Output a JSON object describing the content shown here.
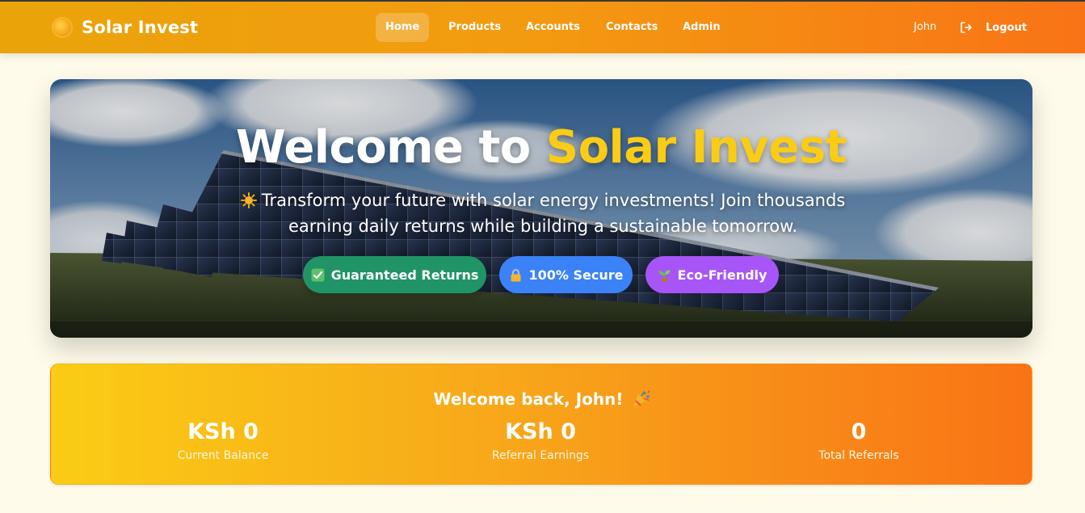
{
  "navbar": {
    "brand_icon": "sun-icon",
    "brand_name": "Solar Invest",
    "items": [
      {
        "label": "Home",
        "active": true
      },
      {
        "label": "Products",
        "active": false
      },
      {
        "label": "Accounts",
        "active": false
      },
      {
        "label": "Contacts",
        "active": false
      },
      {
        "label": "Admin",
        "active": false
      }
    ],
    "user_name": "John",
    "logout_icon": "logout-icon",
    "logout_label": "Logout"
  },
  "hero": {
    "title_prefix": "Welcome to ",
    "title_accent": "Solar Invest",
    "subtitle_icon": "sparkle-sun-icon",
    "subtitle": "Transform your future with solar energy investments! Join thousands earning daily returns while building a sustainable tomorrow.",
    "badges": [
      {
        "icon": "check-box-icon",
        "label": "Guaranteed Returns",
        "color": "#209466"
      },
      {
        "icon": "lock-icon",
        "label": "100% Secure",
        "color": "#3b82f6"
      },
      {
        "icon": "seedling-icon",
        "label": "Eco-Friendly",
        "color": "#a855f7"
      }
    ]
  },
  "summary": {
    "greeting": "Welcome back, John!",
    "greeting_icon": "party-popper-icon",
    "stats": [
      {
        "value": "KSh 0",
        "label": "Current Balance"
      },
      {
        "value": "KSh 0",
        "label": "Referral Earnings"
      },
      {
        "value": "0",
        "label": "Total Referrals"
      }
    ]
  },
  "colors": {
    "nav_gradient_start": "#eaa40a",
    "nav_gradient_end": "#f97316",
    "accent_yellow": "#facc15",
    "page_background": "#fffbeb"
  }
}
